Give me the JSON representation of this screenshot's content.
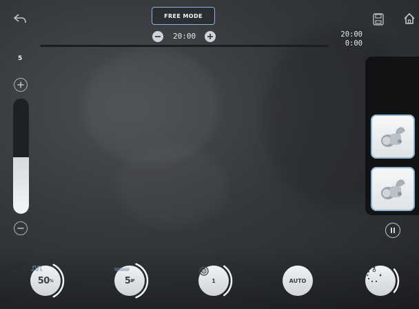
{
  "header": {
    "back_icon": "back-arrow-icon",
    "mode_label": "FREE MODE",
    "save_icon": "save-icon",
    "home_icon": "home-icon"
  },
  "timer": {
    "value": "20:00",
    "decrement_icon": "minus-icon",
    "increment_icon": "plus-icon",
    "total": "20:00",
    "elapsed": "0:00"
  },
  "intensity": {
    "level": "5",
    "fill_fraction": 0.49,
    "increase_icon": "plus-circle-icon",
    "decrease_icon": "minus-circle-icon"
  },
  "applicators": {
    "items": [
      {
        "icon": "handpiece-icon"
      },
      {
        "icon": "handpiece-icon"
      }
    ],
    "pause_icon": "pause-icon"
  },
  "controls": {
    "power": {
      "value": "50",
      "unit": "%",
      "icon": "pulse-wave-icon",
      "ring_fraction": 0.35
    },
    "frequency": {
      "value": "5",
      "unit": "IP",
      "icon": "pulse-train-icon",
      "ring_fraction": 0.38
    },
    "handpiece": {
      "value": "1",
      "icon": "spiral-icon",
      "ring_fraction": 0.3
    },
    "mode": {
      "label": "AUTO"
    },
    "pattern": {
      "icon": "rotation-pattern-icon",
      "ring_fraction": 0.22
    }
  },
  "colors": {
    "accent": "#8fb2d6",
    "ring": "#f5f6f7",
    "background": "#34373b"
  }
}
